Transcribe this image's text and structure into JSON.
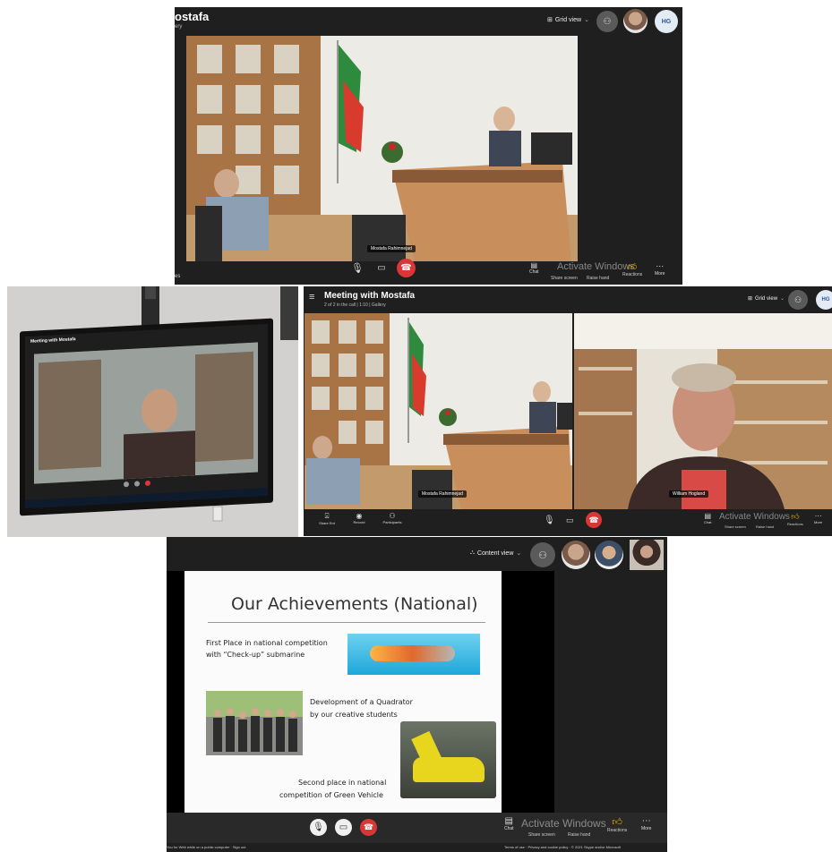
{
  "panel1": {
    "title": "ostafa",
    "subtitle": "ery",
    "view_label": "Grid view",
    "avatar_initials": "HG",
    "name_tag": "Mostafa Rahimnejad",
    "left_corner_text": "es",
    "reaction_labels": [
      "Chat",
      "Share screen",
      "Raise hand",
      "Reactions",
      "More"
    ],
    "watermark": "Activate Windows"
  },
  "panel2": {
    "tv_title": "Meeting with Mostafa"
  },
  "panel3": {
    "title": "Meeting with Mostafa",
    "subtitle": "2 of 2 in the call | 1:10 | Gallery",
    "view_label": "Grid view",
    "avatar_initials": "HG",
    "name_tag_left": "Mostafa Rahimnejad",
    "name_tag_right": "William Hogland",
    "left_controls": [
      "Share Ent",
      "Record",
      "Participants"
    ],
    "reaction_labels": [
      "Chat",
      "Share screen",
      "Raise hand",
      "Reactions",
      "More"
    ],
    "watermark": "Activate Windows"
  },
  "panel4": {
    "view_label": "Content view",
    "slide_title": "Our Achievements (National)",
    "item1_line1": "First Place in national competition",
    "item1_line2": "with “Check-up” submarine",
    "item2_line1": "Development of a Quadrator",
    "item2_line2": "by our creative students",
    "item3_line1": "Second place in national",
    "item3_line2": "competition of Green Vehicle",
    "reaction_labels": [
      "Chat",
      "Share screen",
      "Raise hand",
      "Reactions",
      "More"
    ],
    "watermark": "Activate Windows",
    "footer_left": "You for Web while on a public computer · Sign out",
    "footer_right": "Terms of use · Privacy and cookie policy · © 2021 Skype and/or Microsoft"
  },
  "colors": {
    "meeting_bg": "#1f1f1f",
    "end_call": "#d93636",
    "accent_like": "#f5b400"
  }
}
